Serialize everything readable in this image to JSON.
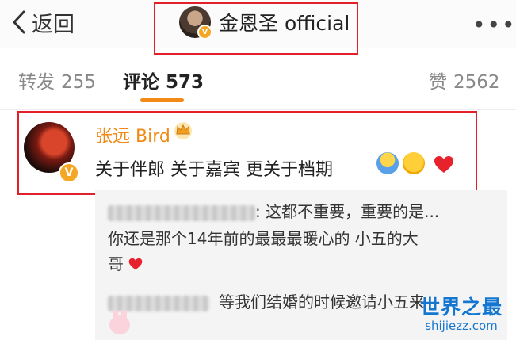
{
  "header": {
    "back_label": "返回",
    "title": "金恩圣 official",
    "more_label": "•••"
  },
  "tabs": [
    {
      "label": "转发",
      "count": "255"
    },
    {
      "label": "评论",
      "count": "573",
      "active": true
    },
    {
      "label": "赞",
      "count": "2562"
    }
  ],
  "comment": {
    "username": "张远 Bird",
    "text": "关于伴郎 关于嘉宾 更关于档期",
    "emojis": [
      "hug-emoji",
      "crying-emoji",
      "red-heart"
    ]
  },
  "replies": [
    {
      "text": ": 这都不重要，重要的是..."
    },
    {
      "text": "你还是那个14年前的最最最暖心的 小五的大"
    },
    {
      "text": "哥"
    },
    {
      "text": "等我们结婚的时候邀请小五来"
    }
  ],
  "watermark": {
    "main": "世界之最",
    "sub": "shijiezz.com"
  },
  "colors": {
    "accent_orange": "#f28b16",
    "username_orange": "#f08a15",
    "highlight_red": "#e2202a",
    "verified_gold": "#f5a623",
    "watermark_blue": "#1576d0"
  }
}
